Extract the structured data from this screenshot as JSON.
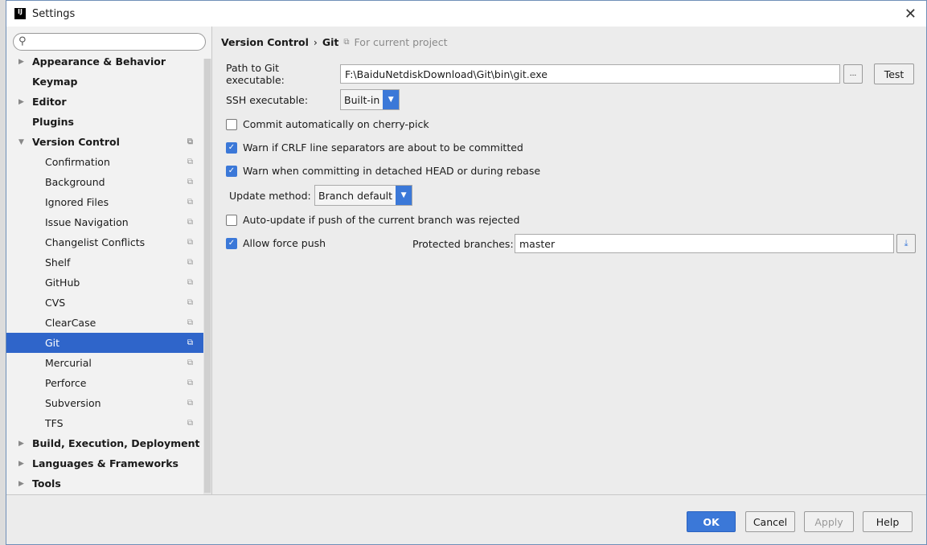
{
  "window": {
    "title": "Settings",
    "app_icon": "intellij-icon",
    "close_icon": "close-icon"
  },
  "search": {
    "value": "",
    "placeholder": ""
  },
  "sidebar": {
    "items": [
      {
        "label": "Appearance & Behavior",
        "level": 0,
        "expandable": true
      },
      {
        "label": "Keymap",
        "level": 0
      },
      {
        "label": "Editor",
        "level": 0,
        "expandable": true
      },
      {
        "label": "Plugins",
        "level": 0
      },
      {
        "label": "Version Control",
        "level": 0,
        "expanded": true,
        "project": true
      },
      {
        "label": "Confirmation",
        "level": 1,
        "project": true
      },
      {
        "label": "Background",
        "level": 1,
        "project": true
      },
      {
        "label": "Ignored Files",
        "level": 1,
        "project": true
      },
      {
        "label": "Issue Navigation",
        "level": 1,
        "project": true
      },
      {
        "label": "Changelist Conflicts",
        "level": 1,
        "project": true
      },
      {
        "label": "Shelf",
        "level": 1,
        "project": true
      },
      {
        "label": "GitHub",
        "level": 1,
        "project": true
      },
      {
        "label": "CVS",
        "level": 1,
        "project": true
      },
      {
        "label": "ClearCase",
        "level": 1,
        "project": true
      },
      {
        "label": "Git",
        "level": 1,
        "project": true,
        "selected": true
      },
      {
        "label": "Mercurial",
        "level": 1,
        "project": true
      },
      {
        "label": "Perforce",
        "level": 1,
        "project": true
      },
      {
        "label": "Subversion",
        "level": 1,
        "project": true
      },
      {
        "label": "TFS",
        "level": 1,
        "project": true
      },
      {
        "label": "Build, Execution, Deployment",
        "level": 0,
        "expandable": true
      },
      {
        "label": "Languages & Frameworks",
        "level": 0,
        "expandable": true
      },
      {
        "label": "Tools",
        "level": 0,
        "expandable": true
      }
    ]
  },
  "main": {
    "breadcrumb": {
      "parent": "Version Control",
      "sep": "›",
      "current": "Git",
      "scope": "For current project"
    },
    "git_path": {
      "label": "Path to Git executable:",
      "value": "F:\\BaiduNetdiskDownload\\Git\\bin\\git.exe",
      "browse": "...",
      "test": "Test"
    },
    "ssh": {
      "label": "SSH executable:",
      "value": "Built-in"
    },
    "checkboxes": [
      {
        "label": "Commit automatically on cherry-pick",
        "checked": false
      },
      {
        "label": "Warn if CRLF line separators are about to be committed",
        "checked": true
      },
      {
        "label": "Warn when committing in detached HEAD or during rebase",
        "checked": true
      }
    ],
    "update_method": {
      "label": "Update method:",
      "value": "Branch default"
    },
    "auto_update": {
      "label": "Auto-update if push of the current branch was rejected",
      "checked": false
    },
    "force_push": {
      "label": "Allow force push",
      "checked": true
    },
    "protected": {
      "label": "Protected branches:",
      "value": "master"
    }
  },
  "footer": {
    "ok": "OK",
    "cancel": "Cancel",
    "apply": "Apply",
    "help": "Help"
  },
  "colors": {
    "accent": "#3b78d8",
    "selection": "#2f65ca"
  }
}
